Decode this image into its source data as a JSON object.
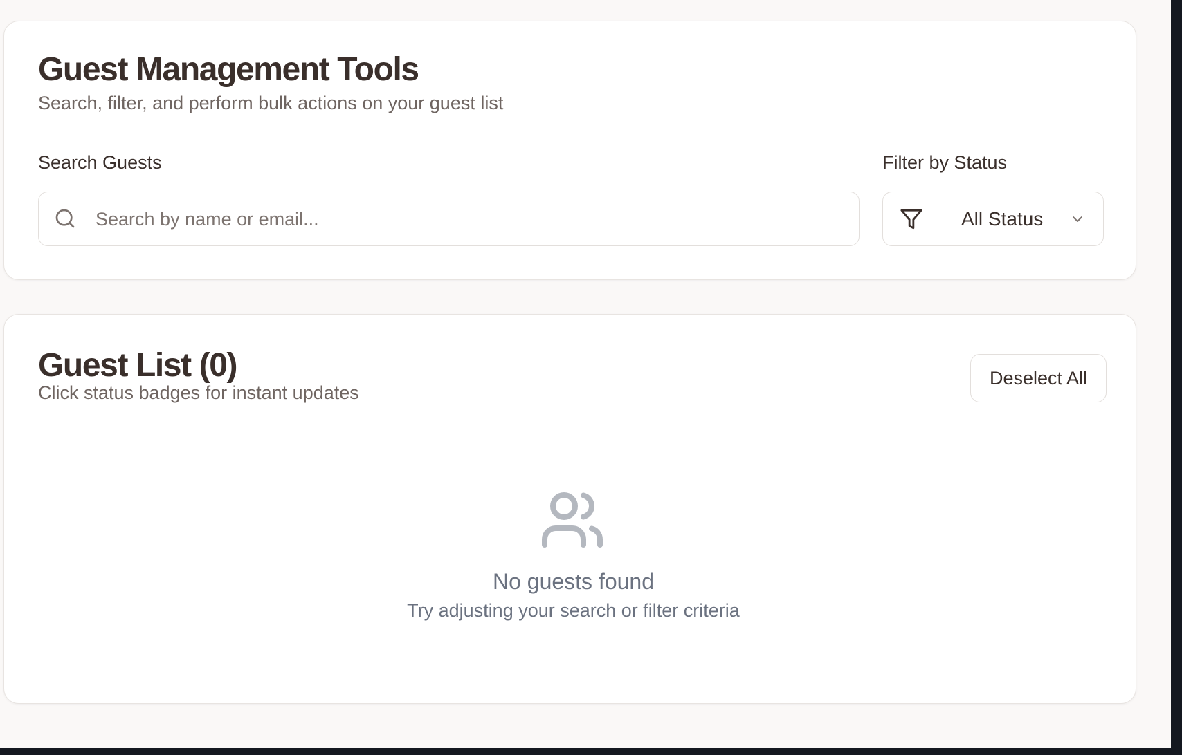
{
  "tools": {
    "title": "Guest Management Tools",
    "subtitle": "Search, filter, and perform bulk actions on your guest list",
    "search_label": "Search Guests",
    "search_placeholder": "Search by name or email...",
    "search_value": "",
    "search_icon": "search-icon",
    "filter_label": "Filter by Status",
    "filter_value": "All Status",
    "filter_icon": "filter-icon",
    "chevron_icon": "chevron-down-icon"
  },
  "guest_list": {
    "title": "Guest List (0)",
    "subtitle": "Click status badges for instant updates",
    "deselect_label": "Deselect All",
    "empty_icon": "users-icon",
    "empty_title": "No guests found",
    "empty_subtitle": "Try adjusting your search or filter criteria"
  },
  "colors": {
    "page_background": "#faf8f7",
    "card_background": "#ffffff",
    "heading_text": "#3a2f2b",
    "muted_text": "#6f6561",
    "empty_state_text": "#6b7280",
    "border": "#e3dfdc"
  }
}
